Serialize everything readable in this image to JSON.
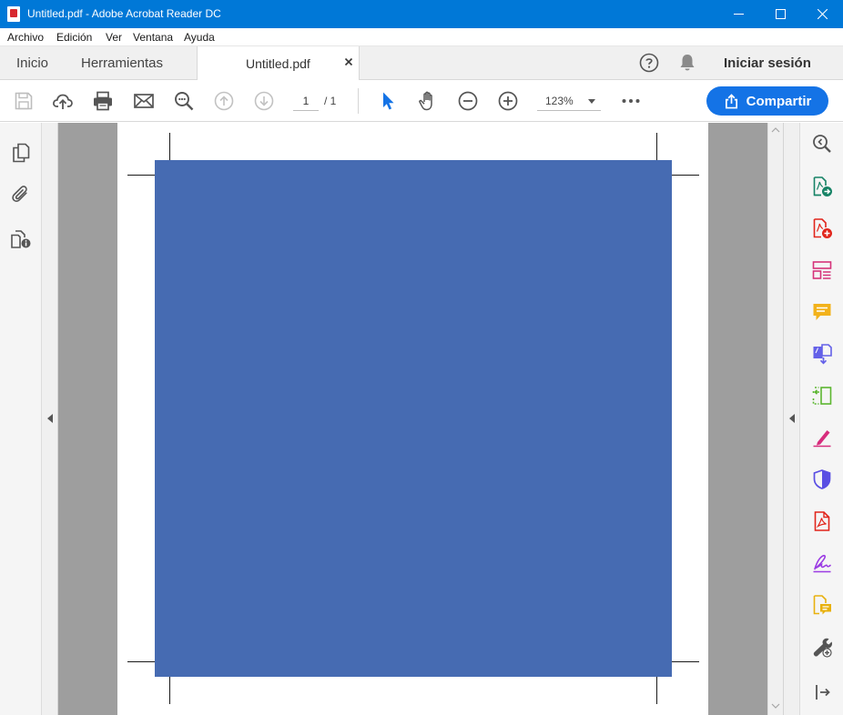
{
  "window": {
    "title": "Untitled.pdf - Adobe Acrobat Reader DC"
  },
  "menu": {
    "items": [
      "Archivo",
      "Edición",
      "Ver",
      "Ventana",
      "Ayuda"
    ]
  },
  "tabs": {
    "home": "Inicio",
    "tools": "Herramientas",
    "document": "Untitled.pdf"
  },
  "header": {
    "signin": "Iniciar sesión"
  },
  "toolbar": {
    "page_current": "1",
    "page_total": "/  1",
    "zoom": "123%",
    "share_label": "Compartir"
  },
  "colors": {
    "accent": "#1473e6",
    "titlebar": "#0078d7",
    "page_shape": "#466bb2"
  },
  "tools_icons": [
    "search-zoom-icon",
    "export-pdf-icon",
    "create-pdf-icon",
    "edit-pdf-icon",
    "comment-icon",
    "combine-files-icon",
    "organize-pages-icon",
    "fill-sign-icon",
    "protect-icon",
    "adobe-pdf-icon",
    "request-signature-icon",
    "send-comments-icon",
    "more-tools-icon",
    "expand-panel-icon"
  ]
}
